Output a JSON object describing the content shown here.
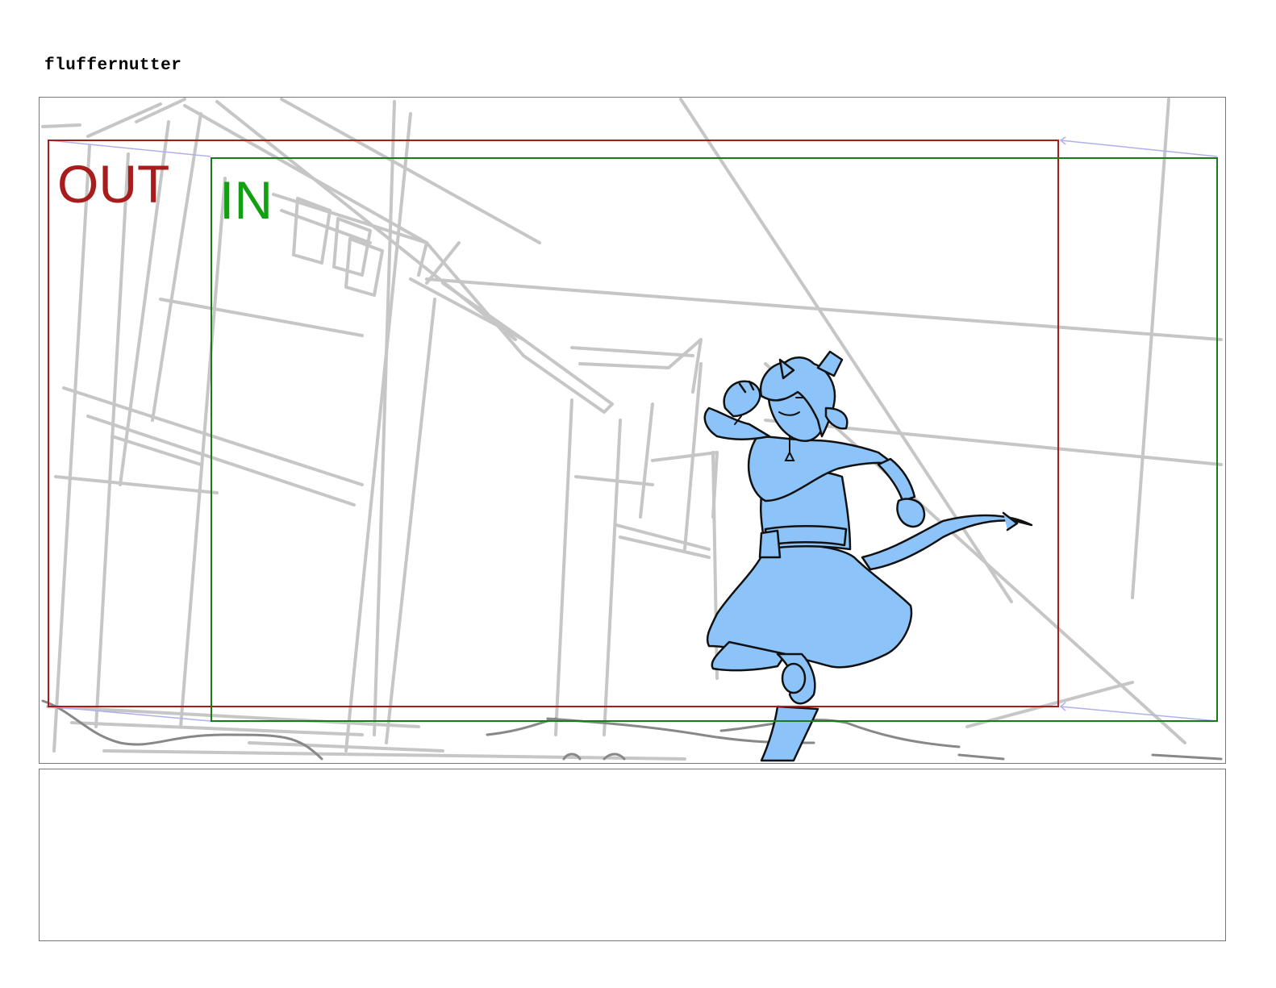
{
  "page": {
    "title": "fluffernutter"
  },
  "panel": {
    "out_label": "OUT",
    "in_label": "IN",
    "colors": {
      "out_frame": "#a81c1c",
      "in_frame": "#1a7a1a",
      "in_text": "#12a012",
      "character_fill": "#8cc4fa",
      "sketch_lines": "#c4c4c4",
      "camera_move_arrow": "#b0b0ee"
    }
  },
  "notes": {
    "text": ""
  }
}
